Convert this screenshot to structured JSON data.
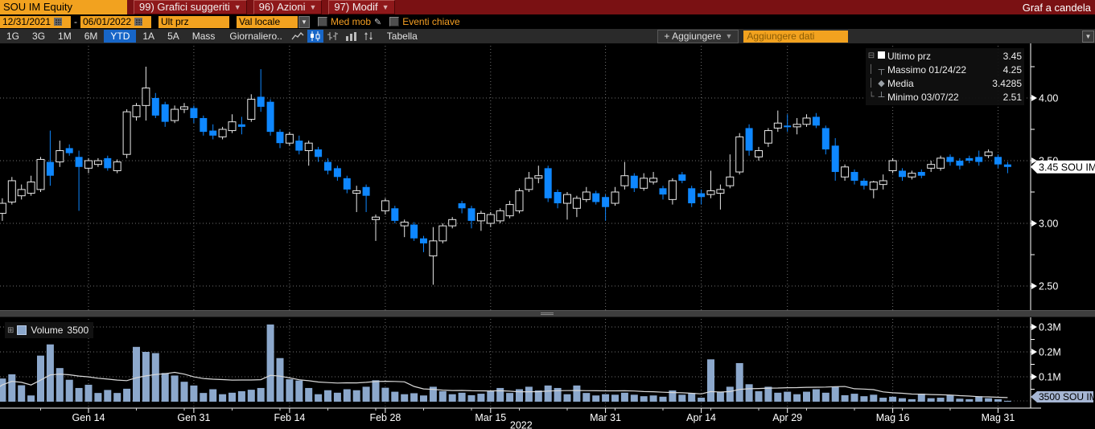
{
  "window": {
    "chart_type_title": "Graf a candela"
  },
  "toolbar_top": {
    "ticker": "SOU IM Equity",
    "menus": [
      {
        "key": "99)",
        "label": "Grafici suggeriti"
      },
      {
        "key": "96)",
        "label": "Azioni"
      },
      {
        "key": "97)",
        "label": "Modif"
      }
    ]
  },
  "toolbar_fields": {
    "date_from": "12/31/2021",
    "date_separator": "-",
    "date_to": "06/01/2022",
    "price_type": "Ult prz",
    "currency_mode": "Val locale",
    "med_mob_label": "Med mob",
    "eventi_label": "Eventi chiave"
  },
  "toolbar_tabs": {
    "ranges": [
      "1G",
      "3G",
      "1M",
      "6M",
      "YTD",
      "1A",
      "5A",
      "Mass"
    ],
    "selected_range": "YTD",
    "period": "Giornaliero..",
    "table_label": "Tabella",
    "add_button": "+ Aggiungere",
    "add_input_placeholder": "Aggiungere dati"
  },
  "legend": {
    "rows": [
      {
        "icon": "square",
        "label": "Ultimo prz",
        "value": "3.45"
      },
      {
        "icon": "top-marker",
        "label": "Massimo 01/24/22",
        "value": "4.25"
      },
      {
        "icon": "diamond",
        "label": "Media",
        "value": "3.4285"
      },
      {
        "icon": "bottom-marker",
        "label": "Minimo 03/07/22",
        "value": "2.51"
      }
    ]
  },
  "volume_legend": {
    "label": "Volume",
    "value": "3500"
  },
  "price_tag": "3.45 SOU IM",
  "volume_tag": "3500 SOU IM",
  "colors": {
    "amber": "#f2a21f",
    "red_bar": "#7a1113",
    "selected_blue": "#1766c8",
    "candle_down": "#0e87ff",
    "candle_up_stroke": "#e8e8e8",
    "volume_bar": "#8ca8cc",
    "volume_ma_line": "#d9d9d9",
    "grid": "#6f6f6f",
    "price_tag_bg": "#ffffff",
    "volume_tag_bg": "#a6b6d4"
  },
  "chart_data": {
    "type": "candlestick",
    "title": "SOU IM Equity - Graf a candela",
    "date_range": [
      "12/31/2021",
      "06/01/2022"
    ],
    "stats": {
      "ultimo_prz": 3.45,
      "massimo": {
        "date": "01/24/22",
        "value": 4.25
      },
      "media": 3.4285,
      "minimo": {
        "date": "03/07/22",
        "value": 2.51
      }
    },
    "price_axis": {
      "tick_labels": [
        "4.00",
        "3.50",
        "3.00",
        "2.50"
      ],
      "ticks": [
        4.0,
        3.5,
        3.0,
        2.5
      ],
      "minor_step": 0.25,
      "ylim": [
        2.32,
        4.44
      ]
    },
    "volume_axis": {
      "tick_labels": [
        "0.3M",
        "0.2M",
        "0.1M"
      ],
      "ticks_m": [
        0.3,
        0.2,
        0.1
      ],
      "minor_step_m": 0.05,
      "ylim_m": [
        0,
        0.32
      ]
    },
    "x_ticks": [
      {
        "label": "Gen 14",
        "i": 10
      },
      {
        "label": "Gen 31",
        "i": 21
      },
      {
        "label": "Feb 14",
        "i": 31
      },
      {
        "label": "Feb 28",
        "i": 41
      },
      {
        "label": "Mar 15",
        "i": 52
      },
      {
        "label": "Mar 31",
        "i": 64
      },
      {
        "label": "Apr 14",
        "i": 74
      },
      {
        "label": "Apr 29",
        "i": 83
      },
      {
        "label": "Mag 16",
        "i": 94
      },
      {
        "label": "Mag 31",
        "i": 105
      }
    ],
    "year_label": "2022",
    "candles_ohlc": [
      [
        2.94,
        3.1,
        2.9,
        3.08
      ],
      [
        3.08,
        3.2,
        3.02,
        3.16
      ],
      [
        3.17,
        3.37,
        3.15,
        3.34
      ],
      [
        3.22,
        3.31,
        3.19,
        3.27
      ],
      [
        3.24,
        3.38,
        3.22,
        3.33
      ],
      [
        3.27,
        3.53,
        3.25,
        3.51
      ],
      [
        3.49,
        3.74,
        3.3,
        3.38
      ],
      [
        3.49,
        3.66,
        3.45,
        3.58
      ],
      [
        3.6,
        3.63,
        3.54,
        3.56
      ],
      [
        3.53,
        3.58,
        3.1,
        3.45
      ],
      [
        3.44,
        3.52,
        3.4,
        3.5
      ],
      [
        3.47,
        3.52,
        3.45,
        3.5
      ],
      [
        3.52,
        3.54,
        3.42,
        3.44
      ],
      [
        3.42,
        3.51,
        3.4,
        3.49
      ],
      [
        3.55,
        3.91,
        3.52,
        3.89
      ],
      [
        3.85,
        3.96,
        3.82,
        3.94
      ],
      [
        3.94,
        4.25,
        3.82,
        4.08
      ],
      [
        4.0,
        4.04,
        3.84,
        3.86
      ],
      [
        3.95,
        3.97,
        3.77,
        3.81
      ],
      [
        3.82,
        3.94,
        3.8,
        3.91
      ],
      [
        3.91,
        3.96,
        3.88,
        3.93
      ],
      [
        3.92,
        3.94,
        3.8,
        3.84
      ],
      [
        3.84,
        3.86,
        3.7,
        3.73
      ],
      [
        3.74,
        3.79,
        3.67,
        3.7
      ],
      [
        3.69,
        3.77,
        3.67,
        3.75
      ],
      [
        3.74,
        3.87,
        3.72,
        3.81
      ],
      [
        3.79,
        3.85,
        3.71,
        3.77
      ],
      [
        3.83,
        4.03,
        3.81,
        3.99
      ],
      [
        4.01,
        4.23,
        3.89,
        3.93
      ],
      [
        3.97,
        3.99,
        3.7,
        3.73
      ],
      [
        3.73,
        3.75,
        3.6,
        3.64
      ],
      [
        3.64,
        3.73,
        3.62,
        3.71
      ],
      [
        3.66,
        3.7,
        3.55,
        3.58
      ],
      [
        3.58,
        3.66,
        3.46,
        3.64
      ],
      [
        3.59,
        3.61,
        3.49,
        3.53
      ],
      [
        3.49,
        3.52,
        3.39,
        3.42
      ],
      [
        3.44,
        3.46,
        3.34,
        3.37
      ],
      [
        3.36,
        3.38,
        3.24,
        3.27
      ],
      [
        3.24,
        3.3,
        3.09,
        3.26
      ],
      [
        3.29,
        3.31,
        3.09,
        3.22
      ],
      [
        3.03,
        3.07,
        2.86,
        3.05
      ],
      [
        3.1,
        3.2,
        3.07,
        3.18
      ],
      [
        3.12,
        3.14,
        3.0,
        3.02
      ],
      [
        2.98,
        3.03,
        2.89,
        3.01
      ],
      [
        2.99,
        3.01,
        2.86,
        2.88
      ],
      [
        2.88,
        2.9,
        2.77,
        2.84
      ],
      [
        2.74,
        2.97,
        2.51,
        2.86
      ],
      [
        2.86,
        3.0,
        2.84,
        2.98
      ],
      [
        2.98,
        3.05,
        2.96,
        3.03
      ],
      [
        3.16,
        3.18,
        3.08,
        3.12
      ],
      [
        3.12,
        3.14,
        2.96,
        3.02
      ],
      [
        3.02,
        3.1,
        2.94,
        3.08
      ],
      [
        3.0,
        3.09,
        2.97,
        3.07
      ],
      [
        3.02,
        3.12,
        3.0,
        3.1
      ],
      [
        3.06,
        3.18,
        3.04,
        3.15
      ],
      [
        3.1,
        3.28,
        3.08,
        3.26
      ],
      [
        3.27,
        3.41,
        3.25,
        3.36
      ],
      [
        3.36,
        3.46,
        3.32,
        3.38
      ],
      [
        3.44,
        3.46,
        3.17,
        3.2
      ],
      [
        3.25,
        3.27,
        3.12,
        3.16
      ],
      [
        3.16,
        3.25,
        3.03,
        3.23
      ],
      [
        3.12,
        3.22,
        3.05,
        3.2
      ],
      [
        3.19,
        3.29,
        3.17,
        3.25
      ],
      [
        3.24,
        3.26,
        3.15,
        3.17
      ],
      [
        3.21,
        3.23,
        3.02,
        3.13
      ],
      [
        3.16,
        3.29,
        3.14,
        3.25
      ],
      [
        3.3,
        3.49,
        3.27,
        3.38
      ],
      [
        3.38,
        3.4,
        3.25,
        3.28
      ],
      [
        3.28,
        3.4,
        3.26,
        3.36
      ],
      [
        3.33,
        3.41,
        3.31,
        3.36
      ],
      [
        3.28,
        3.3,
        3.19,
        3.23
      ],
      [
        3.19,
        3.36,
        3.15,
        3.34
      ],
      [
        3.39,
        3.41,
        3.32,
        3.34
      ],
      [
        3.28,
        3.3,
        3.13,
        3.16
      ],
      [
        3.24,
        3.27,
        3.15,
        3.21
      ],
      [
        3.23,
        3.42,
        3.2,
        3.26
      ],
      [
        3.24,
        3.31,
        3.11,
        3.27
      ],
      [
        3.3,
        3.55,
        3.28,
        3.37
      ],
      [
        3.41,
        3.72,
        3.39,
        3.69
      ],
      [
        3.76,
        3.79,
        3.54,
        3.58
      ],
      [
        3.53,
        3.61,
        3.5,
        3.58
      ],
      [
        3.64,
        3.76,
        3.61,
        3.74
      ],
      [
        3.76,
        3.9,
        3.73,
        3.8
      ],
      [
        3.78,
        3.87,
        3.73,
        3.77
      ],
      [
        3.77,
        3.84,
        3.71,
        3.79
      ],
      [
        3.79,
        3.87,
        3.77,
        3.84
      ],
      [
        3.85,
        3.88,
        3.76,
        3.78
      ],
      [
        3.76,
        3.78,
        3.55,
        3.59
      ],
      [
        3.62,
        3.68,
        3.34,
        3.41
      ],
      [
        3.37,
        3.47,
        3.34,
        3.45
      ],
      [
        3.41,
        3.43,
        3.31,
        3.34
      ],
      [
        3.34,
        3.36,
        3.27,
        3.3
      ],
      [
        3.27,
        3.34,
        3.2,
        3.33
      ],
      [
        3.31,
        3.39,
        3.27,
        3.34
      ],
      [
        3.42,
        3.52,
        3.4,
        3.5
      ],
      [
        3.42,
        3.44,
        3.34,
        3.37
      ],
      [
        3.37,
        3.42,
        3.35,
        3.4
      ],
      [
        3.41,
        3.43,
        3.36,
        3.38
      ],
      [
        3.44,
        3.5,
        3.41,
        3.47
      ],
      [
        3.44,
        3.54,
        3.42,
        3.52
      ],
      [
        3.53,
        3.55,
        3.46,
        3.49
      ],
      [
        3.5,
        3.52,
        3.43,
        3.46
      ],
      [
        3.52,
        3.54,
        3.48,
        3.5
      ],
      [
        3.53,
        3.58,
        3.46,
        3.49
      ],
      [
        3.54,
        3.59,
        3.52,
        3.57
      ],
      [
        3.53,
        3.55,
        3.44,
        3.47
      ],
      [
        3.47,
        3.49,
        3.4,
        3.45
      ]
    ],
    "volumes_m": [
      0.042,
      0.093,
      0.11,
      0.066,
      0.025,
      0.185,
      0.23,
      0.135,
      0.088,
      0.055,
      0.068,
      0.035,
      0.047,
      0.035,
      0.052,
      0.22,
      0.2,
      0.195,
      0.115,
      0.105,
      0.08,
      0.065,
      0.035,
      0.05,
      0.03,
      0.036,
      0.042,
      0.048,
      0.055,
      0.31,
      0.175,
      0.09,
      0.085,
      0.055,
      0.03,
      0.046,
      0.036,
      0.05,
      0.046,
      0.06,
      0.086,
      0.056,
      0.04,
      0.03,
      0.034,
      0.025,
      0.06,
      0.042,
      0.03,
      0.036,
      0.026,
      0.032,
      0.045,
      0.055,
      0.035,
      0.05,
      0.06,
      0.045,
      0.065,
      0.055,
      0.03,
      0.065,
      0.035,
      0.025,
      0.03,
      0.028,
      0.036,
      0.028,
      0.022,
      0.025,
      0.02,
      0.045,
      0.028,
      0.035,
      0.016,
      0.17,
      0.04,
      0.06,
      0.155,
      0.07,
      0.042,
      0.06,
      0.036,
      0.04,
      0.03,
      0.04,
      0.05,
      0.036,
      0.06,
      0.026,
      0.032,
      0.022,
      0.028,
      0.016,
      0.02,
      0.014,
      0.01,
      0.032,
      0.014,
      0.016,
      0.026,
      0.012,
      0.01,
      0.022,
      0.014,
      0.01,
      0.0035
    ],
    "volume_ma_window": 15
  }
}
